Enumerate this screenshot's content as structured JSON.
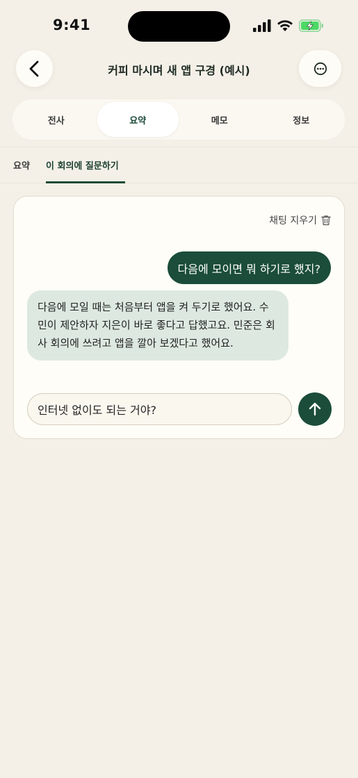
{
  "status_bar": {
    "time": "9:41"
  },
  "header": {
    "title": "커피 마시며 새 앱 구경 (예시)"
  },
  "tabs": [
    {
      "label": "전사",
      "active": false
    },
    {
      "label": "요약",
      "active": true
    },
    {
      "label": "메모",
      "active": false
    },
    {
      "label": "정보",
      "active": false
    }
  ],
  "subtabs": [
    {
      "label": "요약",
      "active": false
    },
    {
      "label": "이 회의에 질문하기",
      "active": true
    }
  ],
  "chat": {
    "clear_label": "채팅 지우기",
    "messages": [
      {
        "role": "user",
        "text": "다음에 모이면 뭐 하기로 했지?"
      },
      {
        "role": "assistant",
        "text": "다음에 모일 때는 처음부터 앱을 켜 두기로 했어요. 수민이 제안하자 지은이 바로 좋다고 답했고요. 민준은 회사 회의에 쓰려고 앱을 깔아 보겠다고 했어요."
      }
    ],
    "input_value": "인터넷 없이도 되는 거야?"
  },
  "colors": {
    "accent": "#1b4d3a",
    "background": "#f4f0e8",
    "ai_bubble": "#dde9e0",
    "battery": "#4cd964"
  },
  "icons": {
    "back": "chevron-left-icon",
    "more": "ellipsis-circle-icon",
    "clear": "trash-icon",
    "send": "arrow-up-icon"
  }
}
